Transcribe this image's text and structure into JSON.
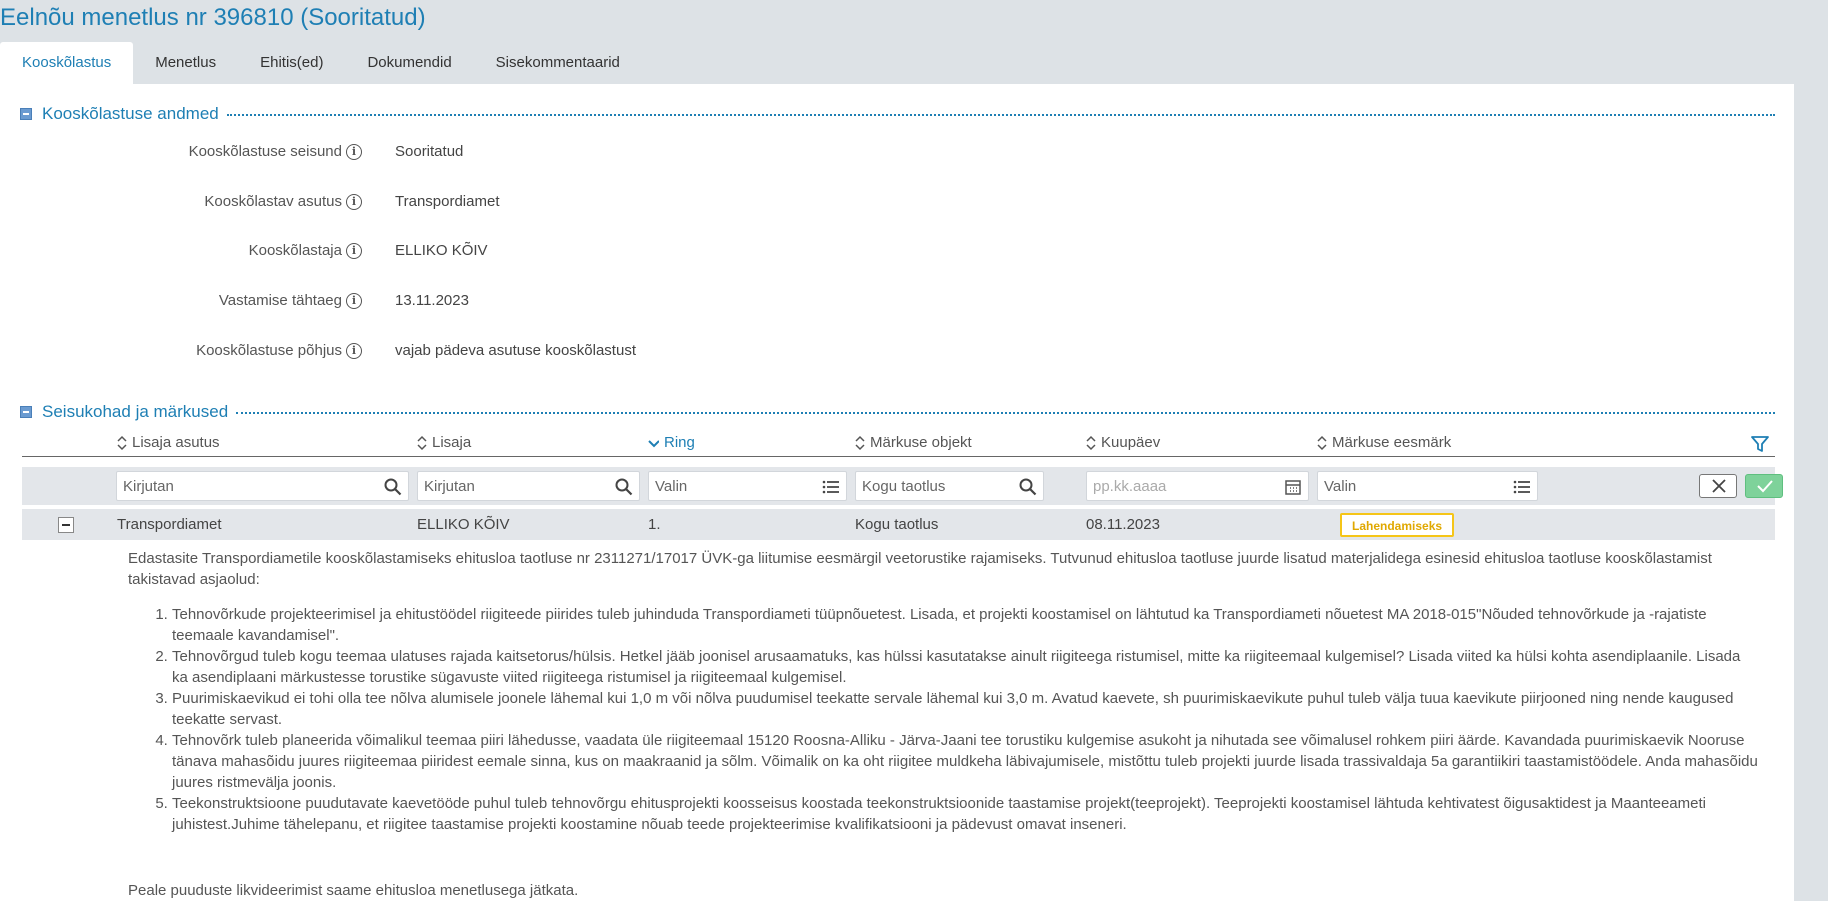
{
  "page": {
    "title": "Eelnõu menetlus nr 396810 (Sooritatud)"
  },
  "tabs": [
    {
      "label": "Kooskõlastus",
      "active": true
    },
    {
      "label": "Menetlus"
    },
    {
      "label": "Ehitis(ed)"
    },
    {
      "label": "Dokumendid"
    },
    {
      "label": "Sisekommentaarid"
    }
  ],
  "details": {
    "section_title": "Kooskõlastuse andmed",
    "fields": [
      {
        "label": "Kooskõlastuse seisund",
        "value": "Sooritatud"
      },
      {
        "label": "Kooskõlastav asutus",
        "value": "Transpordiamet"
      },
      {
        "label": "Kooskõlastaja",
        "value": "ELLIKO KÕIV"
      },
      {
        "label": "Vastamise tähtaeg",
        "value": "13.11.2023"
      },
      {
        "label": "Kooskõlastuse põhjus",
        "value": "vajab pädeva asutuse kooskõlastust"
      }
    ]
  },
  "remarks": {
    "section_title": "Seisukohad ja märkused",
    "columns": [
      {
        "label": "Lisaja asutus"
      },
      {
        "label": "Lisaja"
      },
      {
        "label": "Ring",
        "sorted": "desc"
      },
      {
        "label": "Märkuse objekt"
      },
      {
        "label": "Kuupäev"
      },
      {
        "label": "Märkuse eesmärk"
      }
    ],
    "filters": [
      {
        "value": "Kirjutan",
        "icon": "search-icon"
      },
      {
        "value": "Kirjutan",
        "icon": "search-icon"
      },
      {
        "value": "Valin",
        "icon": "list-icon"
      },
      {
        "value": "Kogu taotlus",
        "icon": "search-icon"
      },
      {
        "placeholder": "pp.kk.aaaa",
        "icon": "calendar-icon"
      },
      {
        "value": "Valin",
        "icon": "list-icon"
      }
    ],
    "row": {
      "asutus": "Transpordiamet",
      "lisaja": "ELLIKO KÕIV",
      "ring": "1.",
      "objekt": "Kogu taotlus",
      "kuupaev": "08.11.2023",
      "eesmark": "Lahendamiseks",
      "eesmark_color": "#f5c518"
    },
    "text": {
      "intro": "Edastasite Transpordiametile kooskõlastamiseks ehitusloa taotluse nr 2311271/17017 ÜVK-ga liitumise eesmärgil veetorustike rajamiseks. Tutvunud ehitusloa taotluse juurde lisatud materjalidega esinesid ehitusloa taotluse kooskõlastamist takistavad asjaolud:",
      "items": [
        "Tehnovõrkude projekteerimisel ja ehitustöödel riigiteede piirides tuleb juhinduda Transpordiameti tüüpnõuetest. Lisada, et projekti koostamisel on lähtutud ka Transpordiameti nõuetest MA 2018-015\"Nõuded tehnovõrkude ja -rajatiste teemaale kavandamisel\".",
        "Tehnovõrgud tuleb kogu teemaa ulatuses rajada kaitsetorus/hülsis. Hetkel jääb joonisel arusaamatuks, kas hülssi kasutatakse ainult riigiteega ristumisel, mitte ka riigiteemaal kulgemisel? Lisada viited ka hülsi kohta asendiplaanile. Lisada ka asendiplaani märkustesse torustike sügavuste viited riigiteega ristumisel ja riigiteemaal kulgemisel.",
        "Puurimiskaevikud ei tohi olla tee nõlva alumisele joonele lähemal kui 1,0 m või nõlva puudumisel teekatte servale lähemal kui 3,0 m. Avatud kaevete, sh puurimiskaevikute puhul tuleb välja tuua kaevikute piirjooned ning nende kaugused teekatte servast.",
        "Tehnovõrk tuleb planeerida võimalikul teemaa piiri lähedusse, vaadata üle riigiteemaal 15120 Roosna-Alliku - Järva-Jaani tee torustiku kulgemise asukoht ja nihutada see võimalusel rohkem piiri äärde. Kavandada puurimiskaevik Nooruse tänava mahasõidu juures riigiteemaa piiridest eemale sinna, kus on maakraanid ja sõlm. Võimalik on ka oht riigitee muldkeha läbivajumisele, mistõttu tuleb projekti juurde lisada trassivaldaja 5a garantiikiri taastamistöödele. Anda mahasõidu juures ristmevälja joonis.",
        "Teekonstruktsioone puudutavate kaevetööde puhul tuleb tehnovõrgu ehitusprojekti koosseisus koostada teekonstruktsioonide taastamise projekt(teeprojekt). Teeprojekti koostamisel lähtuda kehtivatest õigusaktidest ja Maanteeameti juhistest.Juhime tähelepanu, et riigitee taastamise projekti koostamine nõuab teede projekteerimise kvalifikatsiooni ja pädevust omavat inseneri."
      ],
      "closing": "Peale puuduste likvideerimist saame ehitusloa menetlusega jätkata."
    }
  },
  "colors": {
    "accent": "#1e7fb4",
    "background": "#dde2e6",
    "row_bg": "#e3e6ea",
    "confirm": "#7ed29a"
  }
}
